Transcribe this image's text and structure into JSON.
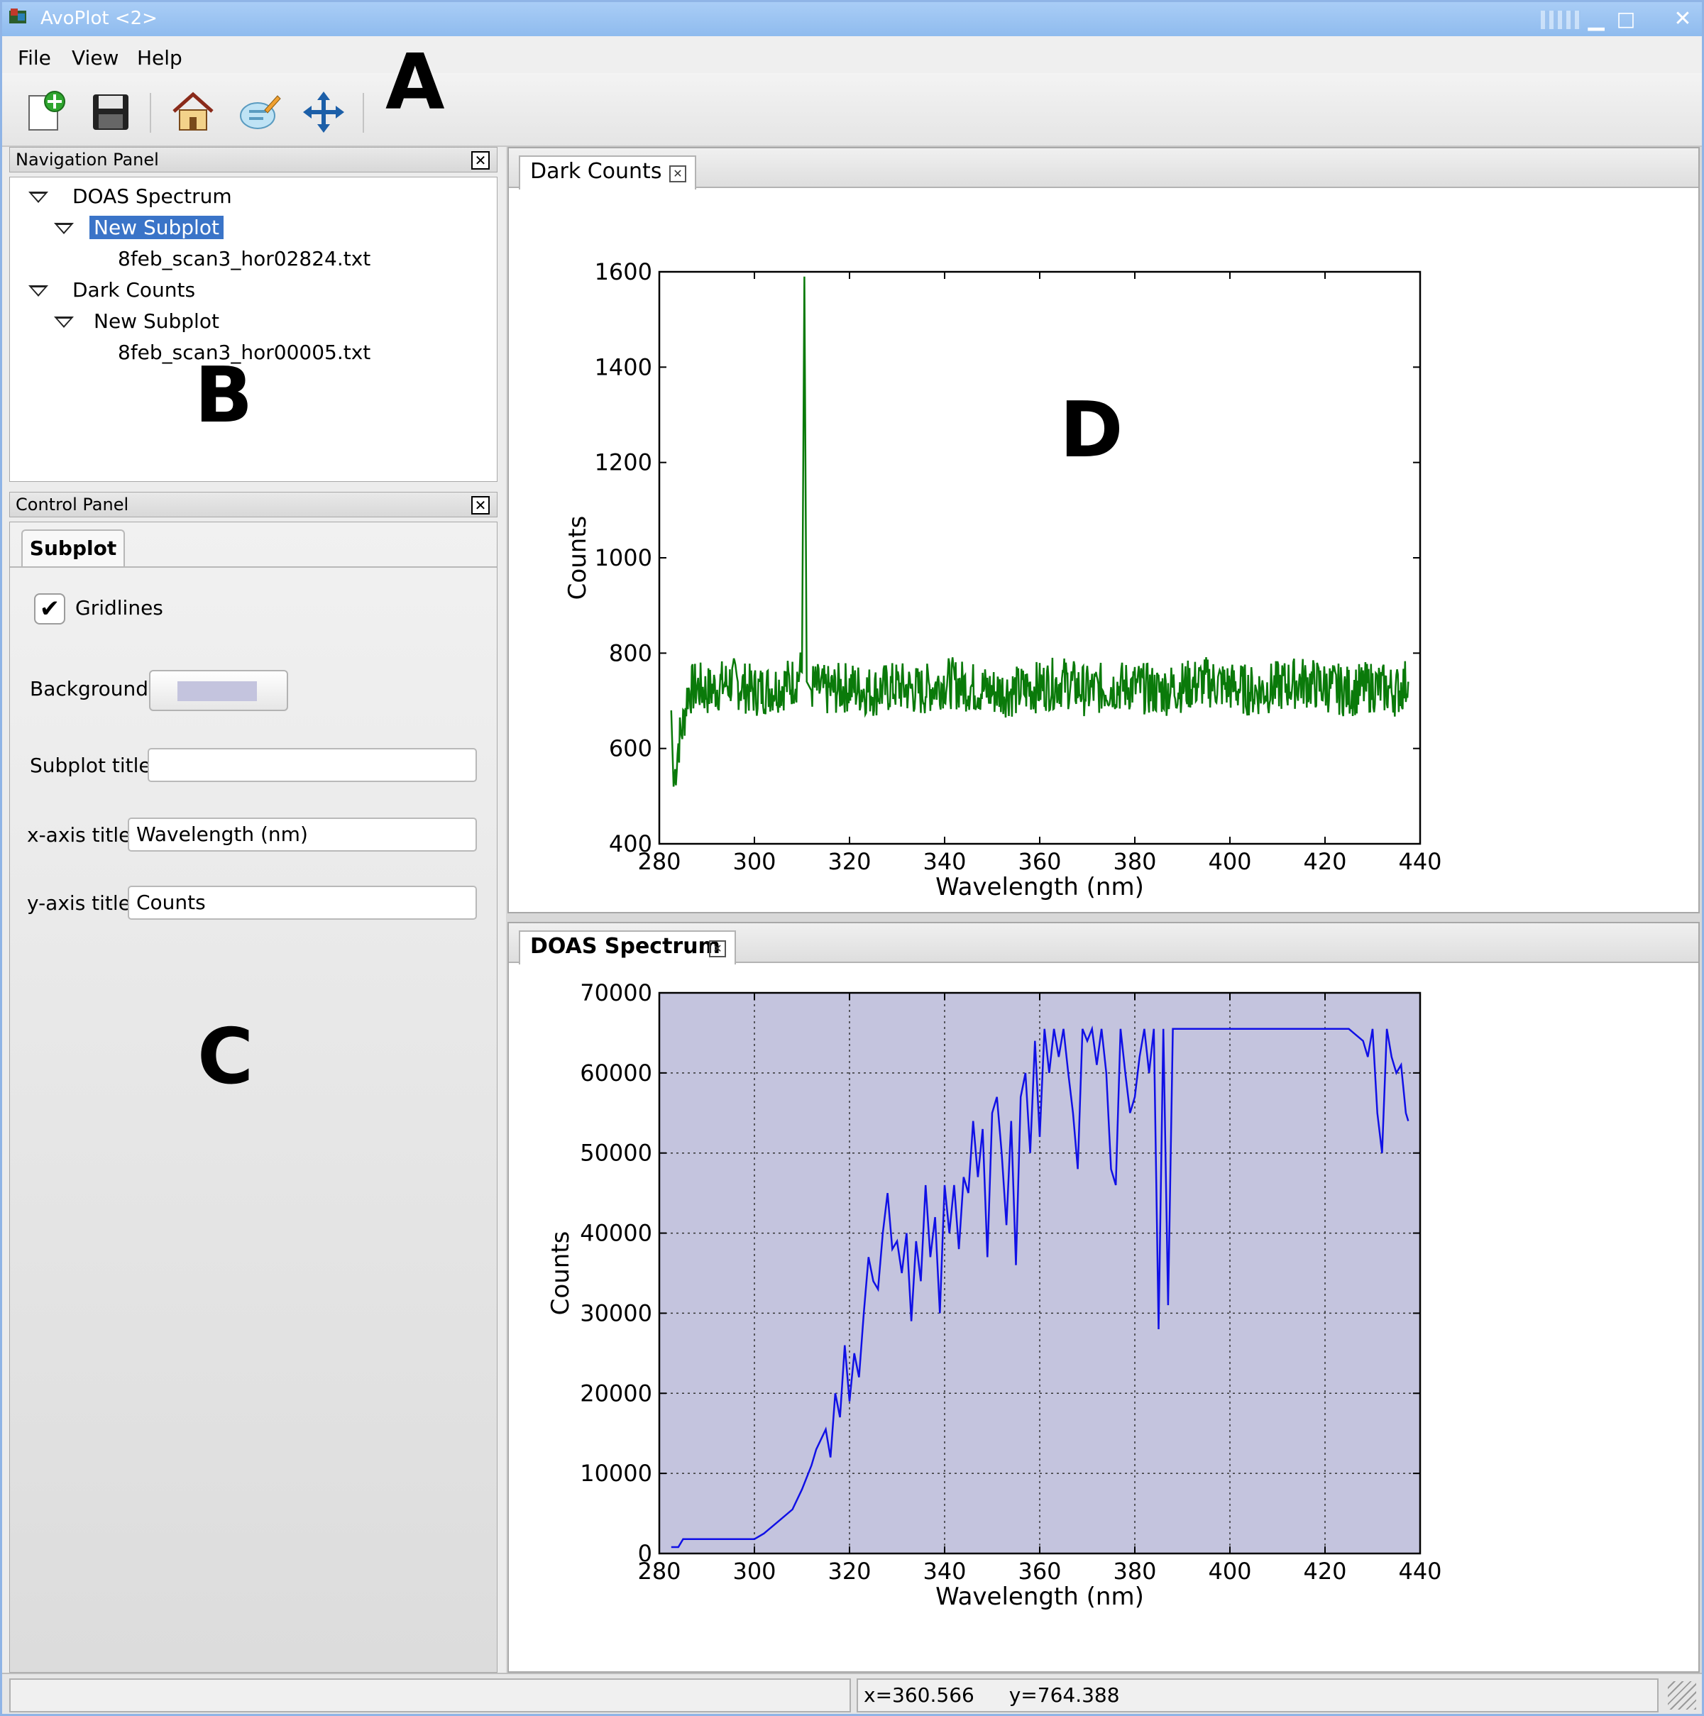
{
  "window": {
    "title": "AvoPlot <2>"
  },
  "menu": {
    "file": "File",
    "view": "View",
    "help": "Help"
  },
  "annotations": {
    "a": "A",
    "b": "B",
    "c": "C",
    "d": "D"
  },
  "toolbar": {
    "icons": [
      "new-plot-icon",
      "save-icon",
      "home-icon",
      "edit-icon",
      "move-icon"
    ]
  },
  "nav_panel": {
    "title": "Navigation Panel",
    "tree": [
      {
        "label": "DOAS Spectrum"
      },
      {
        "label": "New Subplot"
      },
      {
        "label": "8feb_scan3_hor02824.txt"
      },
      {
        "label": "Dark Counts"
      },
      {
        "label": "New Subplot"
      },
      {
        "label": "8feb_scan3_hor00005.txt"
      }
    ]
  },
  "control_panel": {
    "title": "Control Panel",
    "tab": "Subplot",
    "gridlines_label": "Gridlines",
    "gridlines_checked": true,
    "background_label": "Background",
    "background_color": "#c4c4de",
    "subplot_title_label": "Subplot title:",
    "subplot_title_value": "",
    "xaxis_title_label": "x-axis title:",
    "xaxis_title_value": "Wavelength (nm)",
    "yaxis_title_label": "y-axis title:",
    "yaxis_title_value": "Counts"
  },
  "docs": {
    "dark_counts_tab": "Dark Counts",
    "doas_tab": "DOAS Spectrum"
  },
  "status": {
    "x": "x=360.566",
    "y": "y=764.388"
  },
  "colors": {
    "dark_line": "#0a7a0a",
    "doas_line": "#1010e6",
    "doas_bg": "#c4c4de",
    "selection": "#3a74c8"
  },
  "chart_data": [
    {
      "type": "line",
      "title": "",
      "xlabel": "Wavelength (nm)",
      "ylabel": "Counts",
      "xlim": [
        280,
        440
      ],
      "ylim": [
        400,
        1600
      ],
      "xticks": [
        "280",
        "300",
        "320",
        "340",
        "360",
        "380",
        "400",
        "420",
        "440"
      ],
      "yticks": [
        "400",
        "600",
        "800",
        "1000",
        "1200",
        "1400",
        "1600"
      ],
      "grid": false,
      "series": [
        {
          "color": "#0a7a0a",
          "x": [
            282.5,
            283,
            284,
            285,
            286,
            288,
            290,
            295,
            300,
            305,
            308,
            310,
            310.5,
            311,
            312,
            315,
            320,
            325,
            330,
            335,
            340,
            345,
            350,
            355,
            360,
            365,
            370,
            375,
            380,
            385,
            390,
            395,
            400,
            405,
            410,
            415,
            420,
            425,
            430,
            435,
            437.5
          ],
          "y": [
            680,
            520,
            610,
            650,
            720,
            730,
            720,
            740,
            720,
            730,
            740,
            760,
            1590,
            740,
            730,
            720,
            730,
            720,
            730,
            720,
            740,
            730,
            720,
            720,
            730,
            740,
            720,
            730,
            730,
            720,
            730,
            740,
            730,
            720,
            730,
            740,
            730,
            720,
            730,
            720,
            740
          ]
        }
      ]
    },
    {
      "type": "line",
      "title": "",
      "xlabel": "Wavelength (nm)",
      "ylabel": "Counts",
      "xlim": [
        280,
        440
      ],
      "ylim": [
        0,
        70000
      ],
      "xticks": [
        "280",
        "300",
        "320",
        "340",
        "360",
        "380",
        "400",
        "420",
        "440"
      ],
      "yticks": [
        "0",
        "10000",
        "20000",
        "30000",
        "40000",
        "50000",
        "60000",
        "70000"
      ],
      "grid": true,
      "series": [
        {
          "color": "#1010e6",
          "x": [
            282.5,
            284,
            285,
            290,
            295,
            300,
            302,
            305,
            308,
            310,
            312,
            313,
            315,
            316,
            317,
            318,
            319,
            320,
            321,
            322,
            323,
            324,
            325,
            326,
            327,
            328,
            329,
            330,
            331,
            332,
            333,
            334,
            335,
            336,
            337,
            338,
            339,
            340,
            341,
            342,
            343,
            344,
            345,
            346,
            347,
            348,
            349,
            350,
            351,
            352,
            353,
            354,
            355,
            356,
            357,
            358,
            359,
            360,
            361,
            362,
            363,
            364,
            365,
            366,
            367,
            368,
            369,
            370,
            371,
            372,
            373,
            374,
            375,
            376,
            377,
            378,
            379,
            380,
            381,
            382,
            383,
            384,
            385,
            386,
            387,
            388,
            389,
            390,
            391,
            392,
            393,
            394,
            395,
            396,
            397,
            398,
            400,
            405,
            410,
            415,
            420,
            425,
            428,
            429,
            430,
            431,
            432,
            433,
            434,
            435,
            436,
            437,
            437.5
          ],
          "y": [
            800,
            800,
            1800,
            1800,
            1800,
            1800,
            2500,
            4000,
            5500,
            8000,
            11000,
            13000,
            15500,
            12000,
            20000,
            17000,
            26000,
            19000,
            25000,
            22000,
            30000,
            37000,
            34000,
            33000,
            40000,
            45000,
            38000,
            39000,
            35000,
            40000,
            29000,
            39000,
            34000,
            46000,
            37000,
            42000,
            30000,
            46000,
            40000,
            46000,
            38000,
            47000,
            45000,
            54000,
            47000,
            53000,
            37000,
            55000,
            57000,
            50000,
            41000,
            54000,
            36000,
            57000,
            60000,
            50000,
            64000,
            52000,
            65500,
            60000,
            65500,
            62000,
            65500,
            60000,
            55000,
            48000,
            65500,
            64000,
            65500,
            61000,
            65500,
            60000,
            48000,
            46000,
            65500,
            60000,
            55000,
            57000,
            62000,
            65500,
            60000,
            65500,
            28000,
            65500,
            31000,
            65500,
            65500,
            65500,
            65500,
            65500,
            65500,
            65500,
            65500,
            65500,
            65500,
            65500,
            65500,
            65500,
            65500,
            65500,
            65500,
            65500,
            64000,
            62000,
            65500,
            55000,
            50000,
            65500,
            62000,
            60000,
            61000,
            55000,
            54000
          ]
        }
      ]
    }
  ]
}
